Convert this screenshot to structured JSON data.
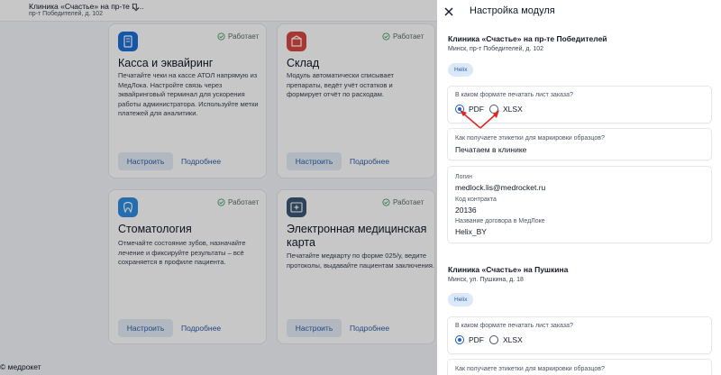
{
  "topbar": {
    "clinic_name": "Клиника «Счастье» на пр-те П...",
    "clinic_address": "пр-т Победителей, д. 102"
  },
  "cards": [
    {
      "title": "Касса и эквайринг",
      "status": "Работает",
      "description": "Печатайте чеки на кассе АТОЛ напрямую из МедЛока. Настройте связь через эквайринговый терминал для ускорения работы администратора. Используйте метки платежей для аналитики.",
      "setup_label": "Настроить",
      "more_label": "Подробнее",
      "icon": "register-icon",
      "icon_color": "#1d6fd8"
    },
    {
      "title": "Склад",
      "status": "Работает",
      "description": "Модуль автоматически списывает препараты, ведёт учёт остатков и формирует отчёт по расходам.",
      "setup_label": "Настроить",
      "more_label": "Подробнее",
      "icon": "warehouse-icon",
      "icon_color": "#d9473f"
    },
    {
      "title": "Стоматология",
      "status": "Работает",
      "description": "Отмечайте состояние зубов, назначайте лечение и фиксируйте результаты – всё сохраняется в профиле пациента.",
      "setup_label": "Настроить",
      "more_label": "Подробнее",
      "icon": "tooth-icon",
      "icon_color": "#2f8ee0"
    },
    {
      "title": "Электронная медицинская карта",
      "status": "Работает",
      "description": "Печатайте медкарту по форме 025/у, ведите протоколы, выдавайте пациентам заключения.",
      "setup_label": "Настроить",
      "more_label": "Подробнее",
      "icon": "medical-card-icon",
      "icon_color": "#3b5673"
    }
  ],
  "footer": {
    "brand": "© медрокет"
  },
  "panel": {
    "title": "Настройка модуля",
    "sections": [
      {
        "clinic_title": "Клиника «Счастье» на пр-те Победителей",
        "address": "Минск, пр-т Победителей, д. 102",
        "chip": "Helix",
        "print_question": "В каком формате печатать лист заказа?",
        "options": [
          "PDF",
          "XLSX"
        ],
        "selected": "PDF",
        "labels_question": "Как получаете этикетки для маркировки образцов?",
        "labels_answer": "Печатаем в клинике",
        "login_label": "Логин",
        "login_value": "medlock.lis@medrocket.ru",
        "contract_label": "Код контракта",
        "contract_value": "20136",
        "agreement_label": "Название договора в МедЛоке",
        "agreement_value": "Helix_BY"
      },
      {
        "clinic_title": "Клиника «Счастье» на Пушкина",
        "address": "Минск, ул. Пушкина, д. 18",
        "chip": "Helix",
        "print_question": "В каком формате печатать лист заказа?",
        "options": [
          "PDF",
          "XLSX"
        ],
        "selected": "PDF",
        "labels_question": "Как получаете этикетки для маркировки образцов?"
      }
    ]
  },
  "colors": {
    "accent": "#1f5fbf",
    "annotation": "#e02424"
  }
}
